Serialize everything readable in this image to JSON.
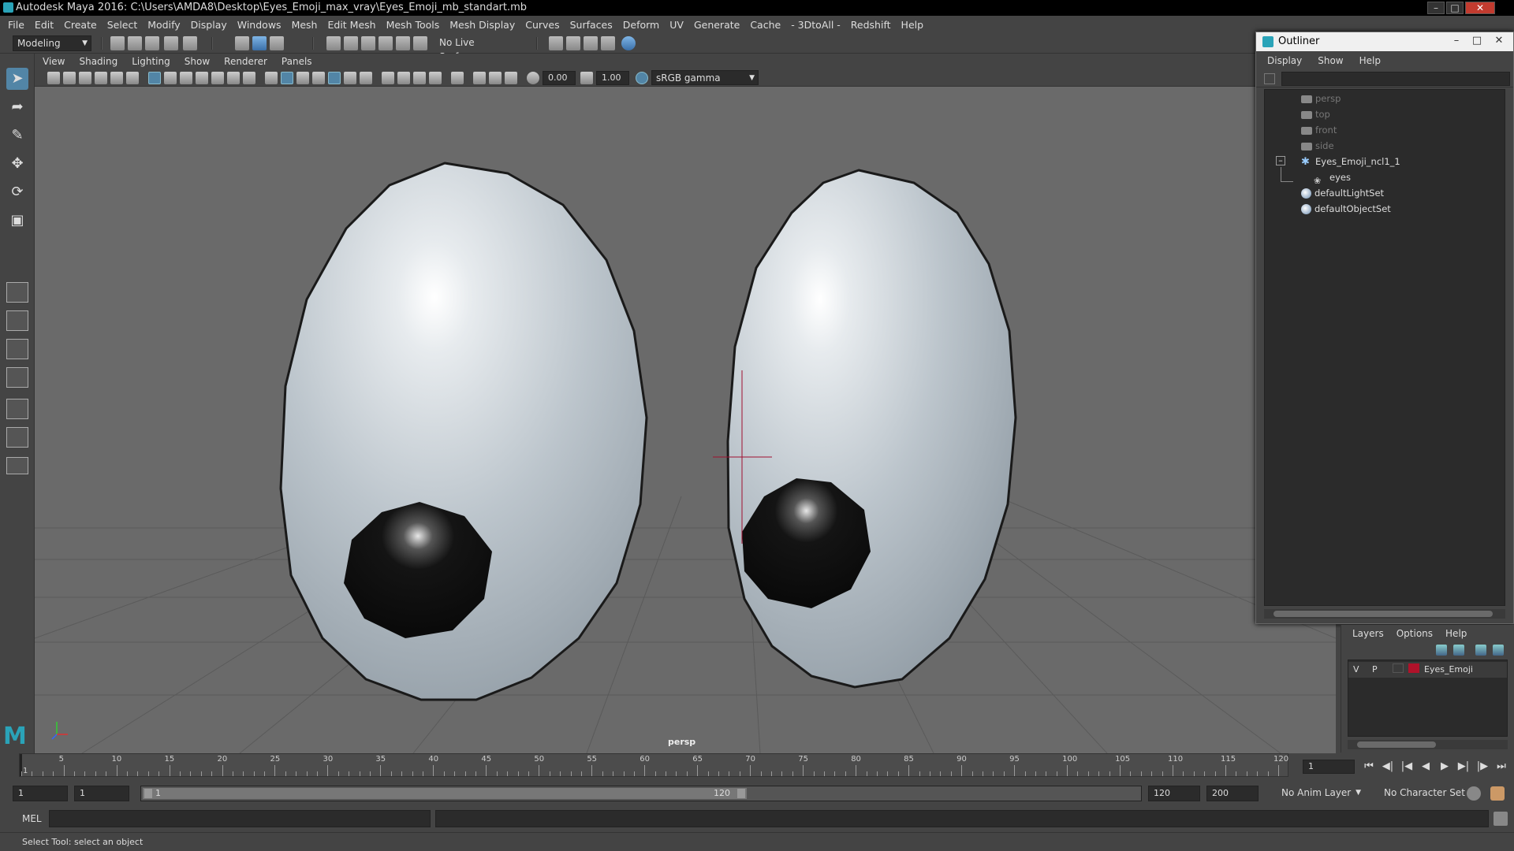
{
  "title": "Autodesk Maya 2016: C:\\Users\\AMDA8\\Desktop\\Eyes_Emoji_max_vray\\Eyes_Emoji_mb_standart.mb",
  "menu": [
    "File",
    "Edit",
    "Create",
    "Select",
    "Modify",
    "Display",
    "Windows",
    "Mesh",
    "Edit Mesh",
    "Mesh Tools",
    "Mesh Display",
    "Curves",
    "Surfaces",
    "Deform",
    "UV",
    "Generate",
    "Cache",
    "- 3DtoAll -",
    "Redshift",
    "Help"
  ],
  "statusline": {
    "mode": "Modeling",
    "live_surface": "No Live Surface"
  },
  "viewport": {
    "menu": [
      "View",
      "Shading",
      "Lighting",
      "Show",
      "Renderer",
      "Panels"
    ],
    "exposure": "0.00",
    "gamma": "1.00",
    "color_space": "sRGB gamma",
    "camera_label": "persp"
  },
  "outliner": {
    "title": "Outliner",
    "menu": [
      "Display",
      "Show",
      "Help"
    ],
    "items": [
      {
        "label": "persp",
        "icon": "camera-icon",
        "dim": true
      },
      {
        "label": "top",
        "icon": "camera-icon",
        "dim": true
      },
      {
        "label": "front",
        "icon": "camera-icon",
        "dim": true
      },
      {
        "label": "side",
        "icon": "camera-icon",
        "dim": true
      },
      {
        "label": "Eyes_Emoji_ncl1_1",
        "icon": "group-icon",
        "dim": false
      },
      {
        "label": "eyes",
        "icon": "mesh-icon",
        "dim": false
      },
      {
        "label": "defaultLightSet",
        "icon": "set-icon",
        "dim": false
      },
      {
        "label": "defaultObjectSet",
        "icon": "set-icon",
        "dim": false
      }
    ]
  },
  "layers": {
    "menu": [
      "Layers",
      "Options",
      "Help"
    ],
    "rows": [
      {
        "visible": "V",
        "playback": "P",
        "name": "Eyes_Emoji",
        "color": "#b0122a"
      }
    ]
  },
  "timeline": {
    "ticks": [
      "5",
      "10",
      "15",
      "20",
      "25",
      "30",
      "35",
      "40",
      "45",
      "50",
      "55",
      "60",
      "65",
      "70",
      "75",
      "80",
      "85",
      "90",
      "95",
      "100",
      "105",
      "110",
      "115",
      "120"
    ],
    "start_marker": "1",
    "current_frame": "1"
  },
  "range": {
    "start": "1",
    "playback_start": "1",
    "bar_start": "1",
    "bar_end": "120",
    "playback_end": "120",
    "end": "200",
    "anim_layer": "No Anim Layer",
    "character_set": "No Character Set"
  },
  "command": {
    "label": "MEL"
  },
  "help_line": "Select Tool: select an object",
  "colors": {
    "accent": "#5285a6",
    "viewport_bg": "#6a6a6a",
    "layer_color": "#b0122a"
  }
}
